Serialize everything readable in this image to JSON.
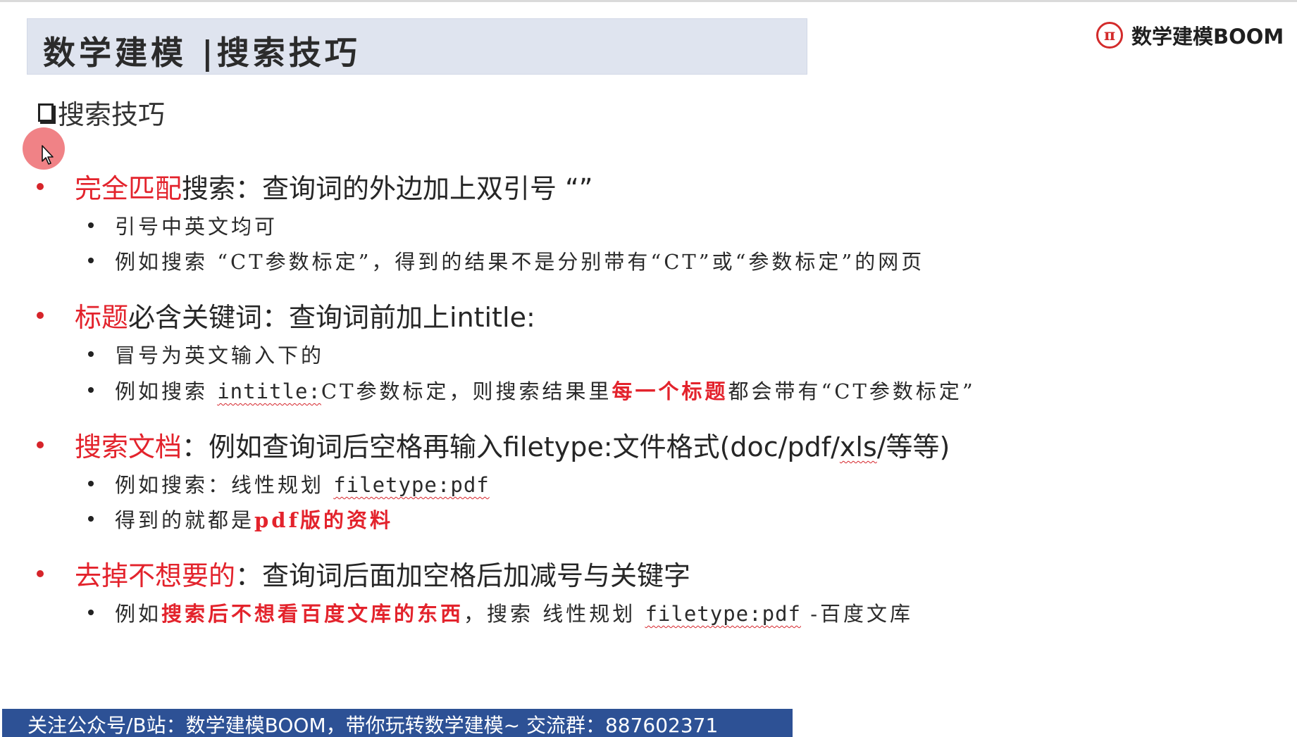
{
  "header": {
    "title": "数学建模 |搜索技巧",
    "brand_logo_glyph": "π",
    "brand_name": "数学建模BOOM"
  },
  "section_title": "搜索技巧",
  "bullets": [
    {
      "highlight": "完全匹配",
      "rest": "搜索：查询词的外边加上双引号 “”",
      "subs": [
        {
          "parts": [
            "引号中英文均可"
          ]
        },
        {
          "parts": [
            "例如搜索 “CT参数标定”，得到的结果不是分别带有“CT”或“参数标定”的网页"
          ]
        }
      ]
    },
    {
      "highlight": "标题",
      "rest": "必含关键词：查询词前加上intitle:",
      "subs": [
        {
          "parts": [
            "冒号为英文输入下的"
          ]
        },
        {
          "parts": [
            "例如搜索 ",
            "intitle:",
            "CT参数标定，则搜索结果里",
            "每一个标题",
            "都会带有“CT参数标定”"
          ]
        }
      ]
    },
    {
      "highlight": "搜索文档",
      "rest_before": "：例如查询词后空格再输入filetype:文件格式(doc/pdf/",
      "rest_squiggle": "xls",
      "rest_after": "/等等)",
      "subs": [
        {
          "parts": [
            "例如搜索：线性规划 ",
            "filetype:pdf"
          ]
        },
        {
          "parts": [
            "得到的就都是",
            "pdf版的资料"
          ]
        }
      ]
    },
    {
      "highlight": "去掉不想要的",
      "rest": "：查询词后面加空格后加减号与关键字",
      "subs": [
        {
          "parts": [
            "例如",
            "搜索后不想看百度文库的东西",
            "，搜索  线性规划 ",
            "filetype:pdf",
            " -百度文库"
          ]
        }
      ]
    }
  ],
  "footer": {
    "text": "关注公众号/B站：数学建模BOOM，带你玩转数学建模~  交流群：887602371"
  },
  "colors": {
    "accent_red": "#e3232c",
    "title_bar_bg": "#dfe4ef",
    "footer_bg": "#2d5195"
  }
}
